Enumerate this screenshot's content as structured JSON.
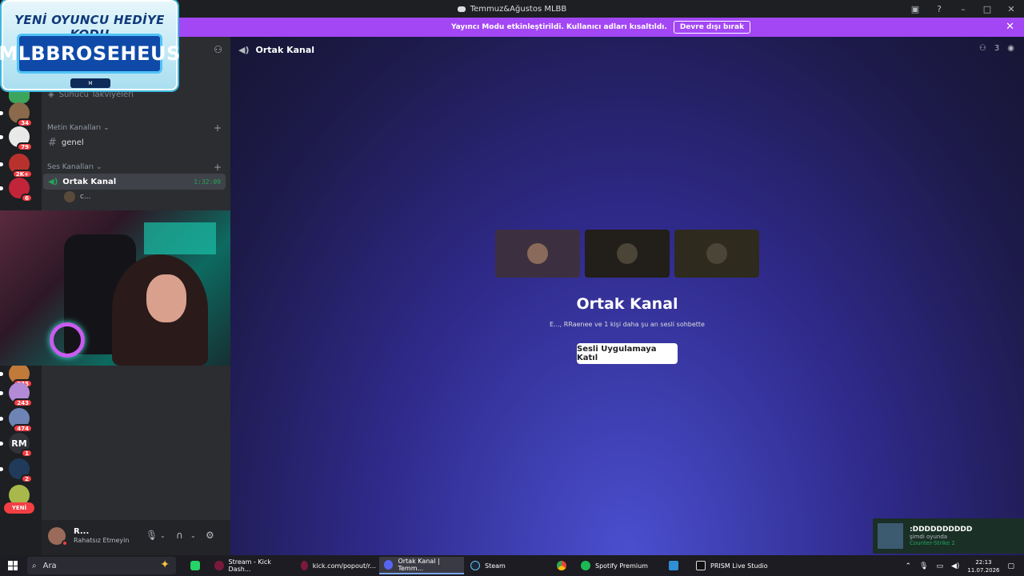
{
  "window": {
    "title": "Temmuz&Ağustos MLBB"
  },
  "promo": {
    "title": "YENİ OYUNCU HEDİYE KODU",
    "code": "MLBBROSEHEUS"
  },
  "streamer_bar": {
    "message": "Yayıncı Modu etkinleştirildi. Kullanıcı adları kısaltıldı.",
    "button": "Devre dışı bırak"
  },
  "servers": [
    {
      "badge": "34"
    },
    {
      "badge": "79"
    },
    {
      "badge": "2K+"
    },
    {
      "badge": "6"
    },
    {
      "badge": "235"
    },
    {
      "badge": "243"
    },
    {
      "badge": "474"
    },
    {
      "label": "RM",
      "badge": "1"
    },
    {
      "badge": "2"
    }
  ],
  "yeni_label": "YENİ",
  "sidebar": {
    "boosts": "Sunucu Takviyeleri",
    "text_category": "Metin Kanalları",
    "voice_category": "Ses Kanalları",
    "text_channels": [
      {
        "name": "genel"
      }
    ],
    "voice_channels": [
      {
        "name": "Ortak Kanal",
        "timer": "1:32:09"
      }
    ],
    "member": "c..."
  },
  "user": {
    "name": "R...",
    "status": "Rahatsız Etmeyin"
  },
  "main": {
    "channel_name": "Ortak Kanal",
    "member_count": "3",
    "vc_title": "Ortak Kanal",
    "vc_subtitle": "E..., RRaenee ve 1 kişi daha şu an sesli sohbette",
    "join_button": "Sesli Uygulamaya Katıl"
  },
  "notification": {
    "name": ":DDDDDDDDDD",
    "sub": "şimdi oyunda",
    "game": "Counter-Strike 2"
  },
  "taskbar": {
    "search": "Ara",
    "items": [
      "Stream - Kick Dash...",
      "kick.com/popout/r...",
      "Ortak Kanal | Temm...",
      "Steam",
      "Spotify Premium",
      "PRISM Live Studio"
    ],
    "time": "22:13",
    "date": "11.07.2026"
  },
  "colors": {
    "streamer_bar": "#a347f5",
    "badge": "#f23f43",
    "voice_green": "#23a55a"
  }
}
